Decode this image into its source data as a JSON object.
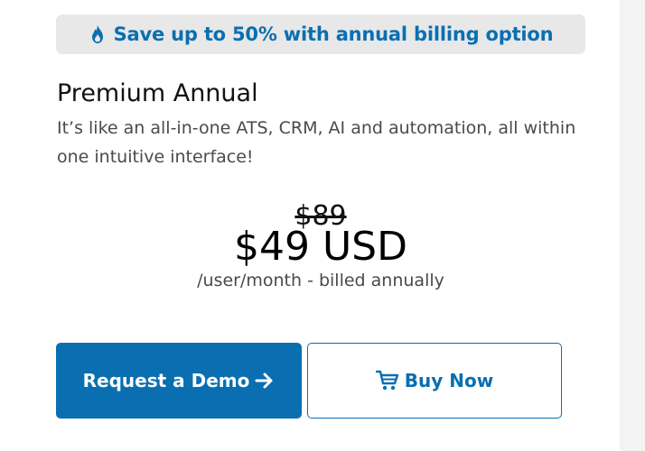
{
  "banner": {
    "icon": "flame-icon",
    "text": "Save up to 50% with annual billing option"
  },
  "plan": {
    "title": "Premium Annual",
    "description": "It’s like an all-in-one ATS, CRM, AI and automation, all within one intuitive interface!"
  },
  "pricing": {
    "original_price": "$89",
    "current_price": "$49 USD",
    "billing_note": "/user/month - billed annually"
  },
  "actions": {
    "demo_label": "Request a Demo",
    "demo_icon": "arrow-right-icon",
    "buy_label": "Buy Now",
    "buy_icon": "cart-icon"
  },
  "colors": {
    "accent": "#0a6fb1",
    "banner_bg": "#e8e8e8",
    "body_text": "#4a4a4a"
  }
}
